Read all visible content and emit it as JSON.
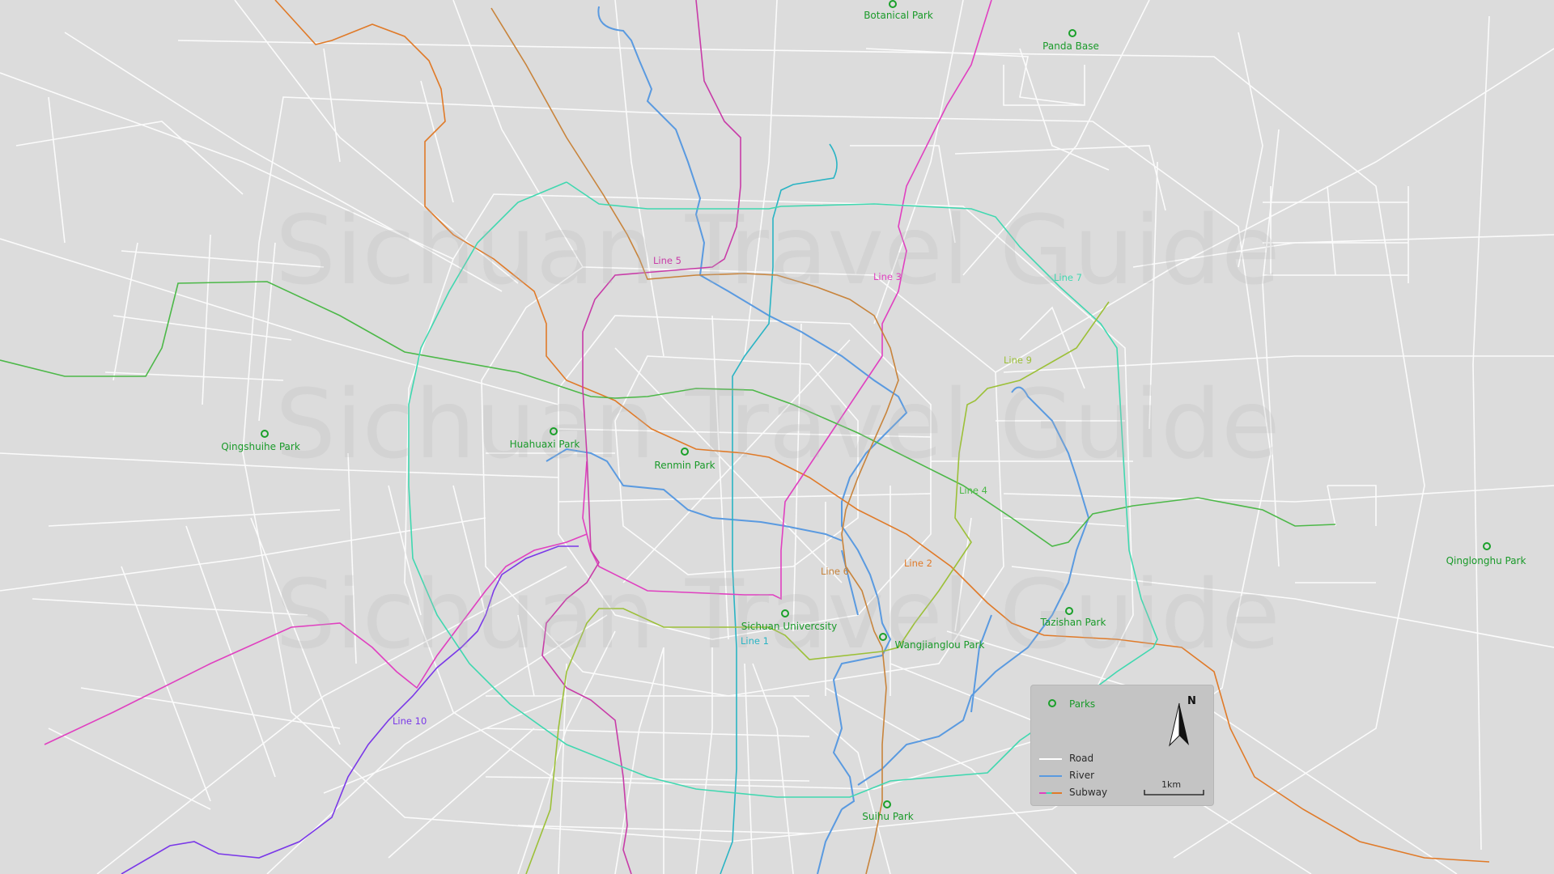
{
  "watermark": "Sichuan Travel Guide",
  "parks": [
    {
      "name": "Botanical Park"
    },
    {
      "name": "Panda Base"
    },
    {
      "name": "Qingshuihe Park"
    },
    {
      "name": "Huahuaxi Park"
    },
    {
      "name": "Renmin Park"
    },
    {
      "name": "Sichuan Univercsity"
    },
    {
      "name": "Wangjianglou Park"
    },
    {
      "name": "Tazishan Park"
    },
    {
      "name": "Qinglonghu Park"
    },
    {
      "name": "Suihu Park"
    }
  ],
  "subway_lines": [
    {
      "name": "Line 1",
      "color": "#2ab4c4"
    },
    {
      "name": "Line 2",
      "color": "#e07a28"
    },
    {
      "name": "Line 3",
      "color": "#e040c0"
    },
    {
      "name": "Line 4",
      "color": "#4cb848"
    },
    {
      "name": "Line 5",
      "color": "#c83ca8"
    },
    {
      "name": "Line 6",
      "color": "#c8843c"
    },
    {
      "name": "Line 7",
      "color": "#40d8b0"
    },
    {
      "name": "Line 9",
      "color": "#9cc038"
    },
    {
      "name": "Line 10",
      "color": "#7a38e8"
    }
  ],
  "colors": {
    "background": "#dcdcdc",
    "road": "#ffffff",
    "river": "#5a9ae0",
    "park": "#1aa02a"
  },
  "legend": {
    "parks_label": "Parks",
    "road_label": "Road",
    "river_label": "River",
    "subway_label": "Subway",
    "north_label": "N",
    "scale_label": "1km"
  }
}
